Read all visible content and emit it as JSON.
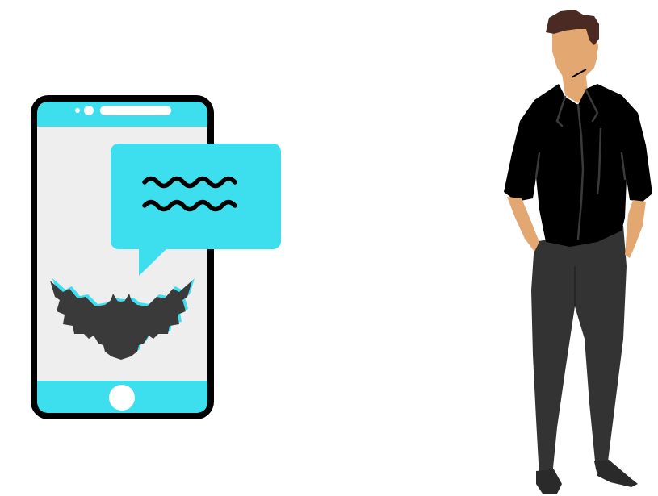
{
  "scene": {
    "background": "#ffffff",
    "phone": {
      "frame_color": "#000000",
      "accent_color": "#3ddfee",
      "screen_color": "#eeeeee",
      "home_button_color": "#ffffff",
      "speaker_color": "#ffffff"
    },
    "speech_bubble": {
      "color": "#3ddfee",
      "icon": "wavy-lines-icon",
      "wave_color": "#000000"
    },
    "owl_logo": {
      "icon": "owl-silhouette-icon",
      "color": "#3a3a3a",
      "outline_color": "#3ddfee"
    },
    "person": {
      "skin_color": "#e3a872",
      "hair_color": "#4a2a22",
      "shirt_color": "#000000",
      "pants_color": "#333333",
      "shoe_color": "#2a2a2a"
    }
  }
}
